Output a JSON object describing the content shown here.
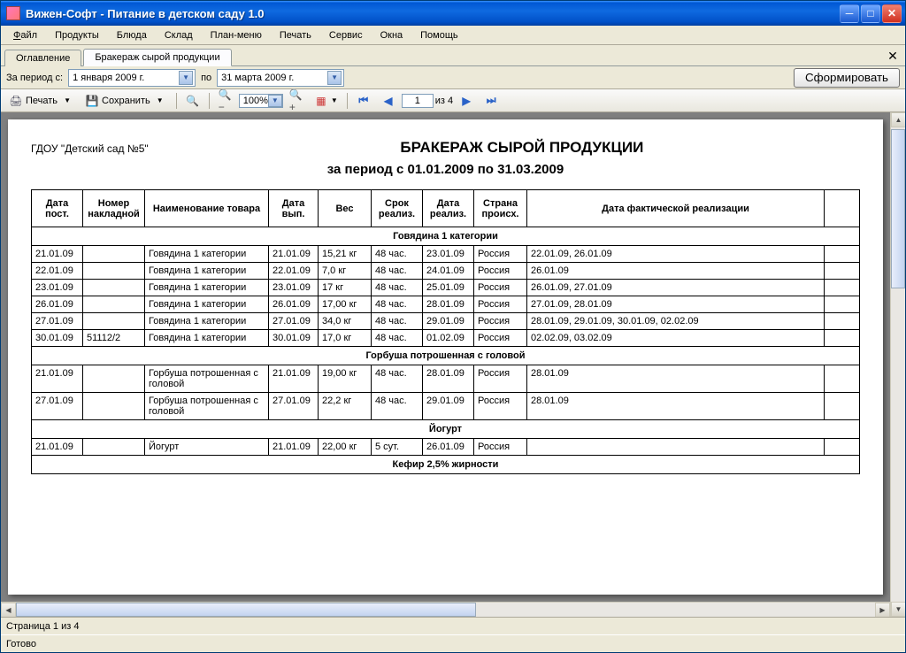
{
  "window": {
    "title": "Вижен-Софт - Питание в детском саду 1.0"
  },
  "menu": {
    "file": "Файл",
    "products": "Продукты",
    "dishes": "Блюда",
    "stock": "Склад",
    "planmenu": "План-меню",
    "print": "Печать",
    "service": "Сервис",
    "windows": "Окна",
    "help": "Помощь"
  },
  "tabs": {
    "toc": "Оглавление",
    "active": "Бракераж сырой продукции"
  },
  "daterow": {
    "period_label": "За период с:",
    "date_from": "1   января   2009 г.",
    "to_label": "по",
    "date_to": "31    марта    2009 г.",
    "form_btn": "Сформировать"
  },
  "toolbar": {
    "print": "Печать",
    "save": "Сохранить",
    "zoom": "100%",
    "page_current": "1",
    "page_of": "из 4"
  },
  "report": {
    "org": "ГДОУ \"Детский сад №5\"",
    "title": "БРАКЕРАЖ СЫРОЙ ПРОДУКЦИИ",
    "subtitle": "за период с 01.01.2009 по 31.03.2009",
    "headers": {
      "date_post": "Дата пост.",
      "invoice": "Номер накладной",
      "name": "Наименование товара",
      "date_prod": "Дата вып.",
      "weight": "Вес",
      "shelf": "Срок реализ.",
      "date_real": "Дата реализ.",
      "country": "Страна происх.",
      "fact": "Дата фактической реализации",
      "blank": ""
    },
    "groups": [
      {
        "title": "Говядина 1 категории",
        "rows": [
          {
            "date_post": "21.01.09",
            "invoice": "",
            "name": "Говядина 1 категории",
            "date_prod": "21.01.09",
            "weight": "15,21 кг",
            "shelf": "48 час.",
            "date_real": "23.01.09",
            "country": "Россия",
            "fact": "22.01.09, 26.01.09"
          },
          {
            "date_post": "22.01.09",
            "invoice": "",
            "name": "Говядина 1 категории",
            "date_prod": "22.01.09",
            "weight": "7,0 кг",
            "shelf": "48 час.",
            "date_real": "24.01.09",
            "country": "Россия",
            "fact": "26.01.09"
          },
          {
            "date_post": "23.01.09",
            "invoice": "",
            "name": "Говядина 1 категории",
            "date_prod": "23.01.09",
            "weight": "17 кг",
            "shelf": "48 час.",
            "date_real": "25.01.09",
            "country": "Россия",
            "fact": "26.01.09, 27.01.09"
          },
          {
            "date_post": "26.01.09",
            "invoice": "",
            "name": "Говядина 1 категории",
            "date_prod": "26.01.09",
            "weight": "17,00 кг",
            "shelf": "48 час.",
            "date_real": "28.01.09",
            "country": "Россия",
            "fact": "27.01.09, 28.01.09"
          },
          {
            "date_post": "27.01.09",
            "invoice": "",
            "name": "Говядина 1 категории",
            "date_prod": "27.01.09",
            "weight": "34,0 кг",
            "shelf": "48 час.",
            "date_real": "29.01.09",
            "country": "Россия",
            "fact": "28.01.09, 29.01.09, 30.01.09, 02.02.09"
          },
          {
            "date_post": "30.01.09",
            "invoice": "51112/2",
            "name": "Говядина 1 категории",
            "date_prod": "30.01.09",
            "weight": "17,0 кг",
            "shelf": "48 час.",
            "date_real": "01.02.09",
            "country": "Россия",
            "fact": "02.02.09, 03.02.09"
          }
        ]
      },
      {
        "title": "Горбуша потрошенная с головой",
        "rows": [
          {
            "date_post": "21.01.09",
            "invoice": "",
            "name": "Горбуша потрошенная с головой",
            "date_prod": "21.01.09",
            "weight": "19,00 кг",
            "shelf": "48 час.",
            "date_real": "28.01.09",
            "country": "Россия",
            "fact": "28.01.09"
          },
          {
            "date_post": "27.01.09",
            "invoice": "",
            "name": "Горбуша потрошенная с головой",
            "date_prod": "27.01.09",
            "weight": "22,2 кг",
            "shelf": "48 час.",
            "date_real": "29.01.09",
            "country": "Россия",
            "fact": "28.01.09"
          }
        ]
      },
      {
        "title": "Йогурт",
        "rows": [
          {
            "date_post": "21.01.09",
            "invoice": "",
            "name": "Йогурт",
            "date_prod": "21.01.09",
            "weight": "22,00 кг",
            "shelf": "5 сут.",
            "date_real": "26.01.09",
            "country": "Россия",
            "fact": ""
          }
        ]
      },
      {
        "title": "Кефир 2,5% жирности",
        "rows": []
      }
    ]
  },
  "status": {
    "page": "Страница 1 из 4",
    "ready": "Готово"
  }
}
